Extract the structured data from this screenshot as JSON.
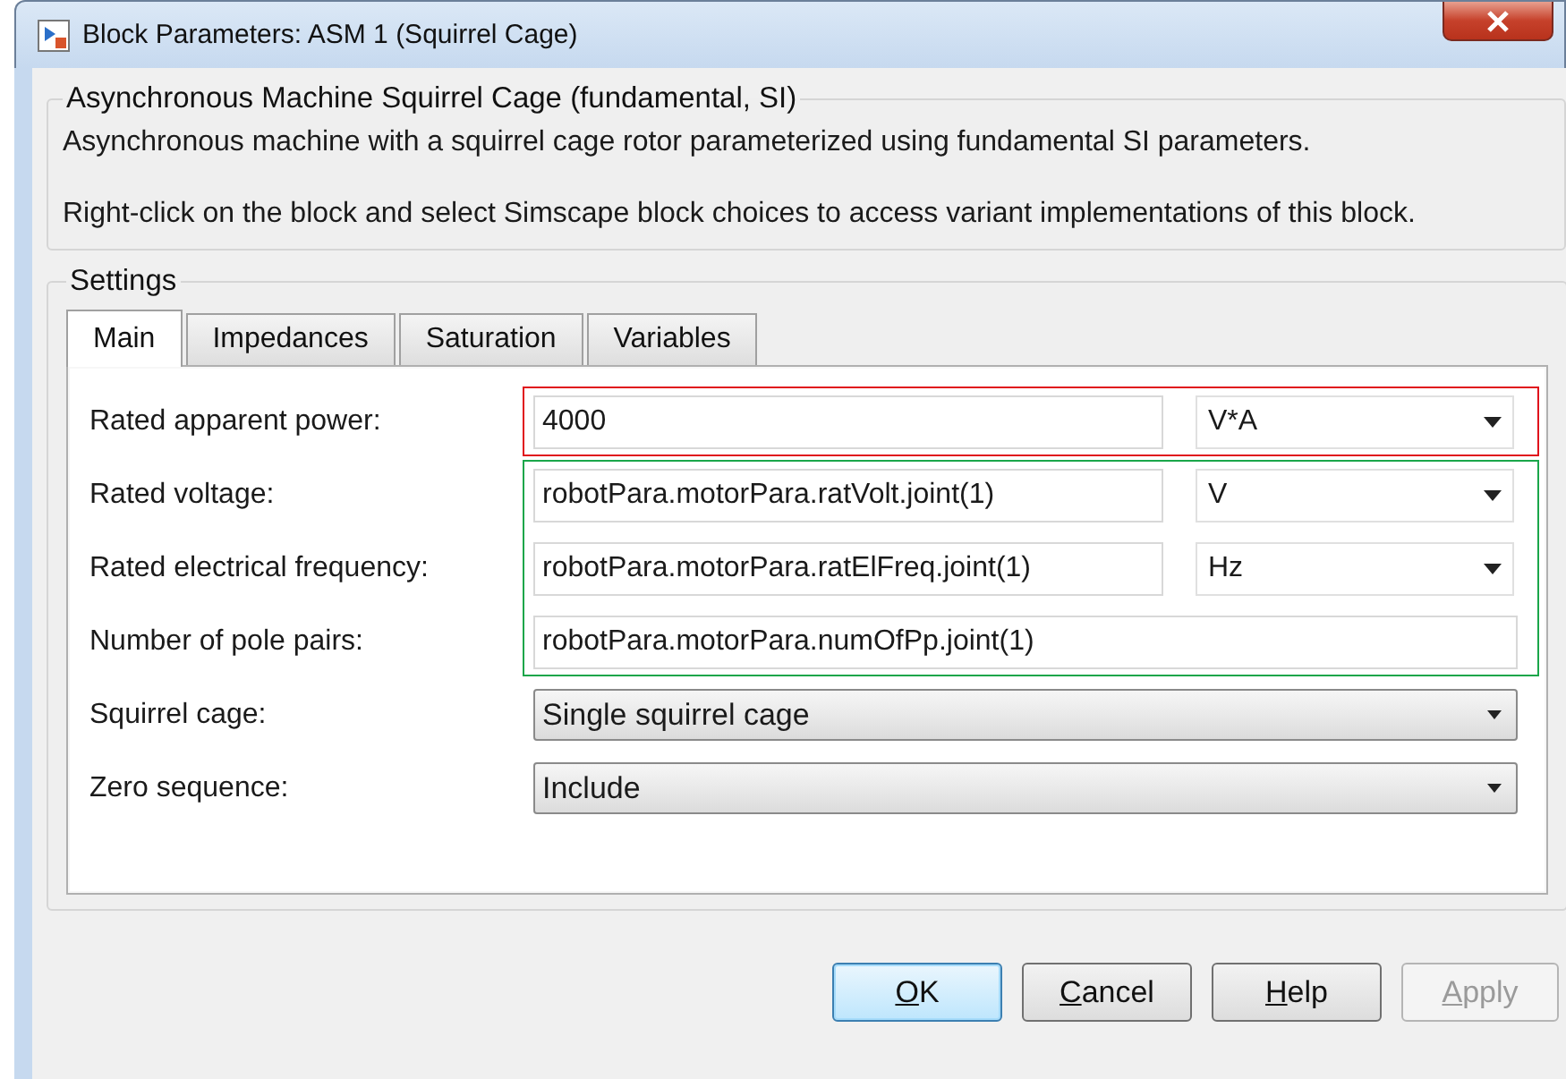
{
  "window": {
    "title": "Block Parameters: ASM 1 (Squirrel Cage)"
  },
  "block": {
    "title": "Asynchronous Machine Squirrel Cage (fundamental, SI)",
    "description": "Asynchronous machine with a squirrel cage rotor parameterized using fundamental SI parameters.",
    "hint": "Right-click on the block and select Simscape block choices to access variant implementations of this block."
  },
  "settings": {
    "title": "Settings",
    "tabs": [
      {
        "label": "Main",
        "selected": true
      },
      {
        "label": "Impedances",
        "selected": false
      },
      {
        "label": "Saturation",
        "selected": false
      },
      {
        "label": "Variables",
        "selected": false
      }
    ],
    "groups": [
      {
        "color": "#e0121c",
        "rows": [
          {
            "kind": "edit-unit",
            "label": "Rated apparent power:",
            "value": "4000",
            "unit": "V*A"
          }
        ]
      },
      {
        "color": "#1aa64a",
        "rows": [
          {
            "kind": "edit-unit",
            "label": "Rated voltage:",
            "value": "robotPara.motorPara.ratVolt.joint(1)",
            "unit": "V"
          },
          {
            "kind": "edit-unit",
            "label": "Rated electrical frequency:",
            "value": "robotPara.motorPara.ratElFreq.joint(1)",
            "unit": "Hz"
          },
          {
            "kind": "edit",
            "label": "Number of pole pairs:",
            "value": "robotPara.motorPara.numOfPp.joint(1)"
          }
        ]
      },
      {
        "rows": [
          {
            "kind": "select",
            "label": "Squirrel cage:",
            "value": "Single squirrel cage"
          },
          {
            "kind": "select",
            "label": "Zero sequence:",
            "value": "Include"
          }
        ]
      }
    ]
  },
  "buttons": [
    {
      "key": "O",
      "rest": "K",
      "default": true,
      "disabled": false
    },
    {
      "key": "C",
      "rest": "ancel",
      "default": false,
      "disabled": false
    },
    {
      "key": "H",
      "rest": "elp",
      "default": false,
      "disabled": false
    },
    {
      "key": "A",
      "rest": "pply",
      "default": false,
      "disabled": true
    }
  ]
}
